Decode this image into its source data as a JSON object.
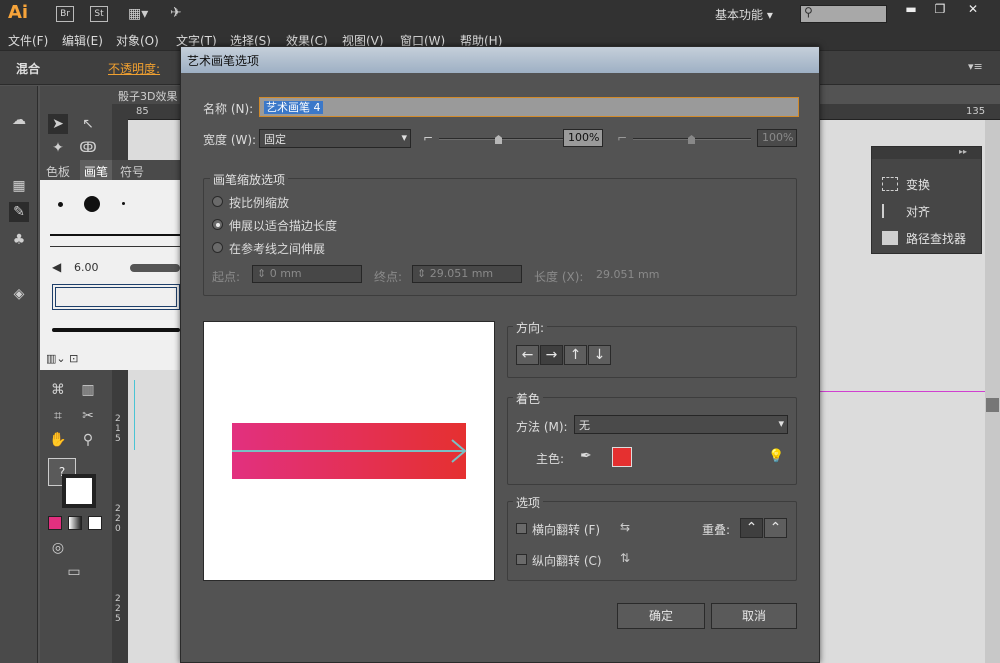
{
  "app": {
    "logo": "Ai",
    "bridge": "Br",
    "stock": "St",
    "workspace": "基本功能",
    "search_placeholder": ""
  },
  "menu": [
    "文件(F)",
    "编辑(E)",
    "对象(O)",
    "文字(T)",
    "选择(S)",
    "效果(C)",
    "视图(V)",
    "窗口(W)",
    "帮助(H)"
  ],
  "control_bar": {
    "blend": "混合",
    "opacity_label": "不透明度:"
  },
  "document_tab": "骰子3D效果",
  "rulers": {
    "top": [
      "85",
      "135"
    ],
    "left": [
      "2 1 5",
      "2 2 0",
      "2 2 5"
    ]
  },
  "brush_panel": {
    "tabs": [
      "色板",
      "画笔",
      "符号"
    ],
    "brush_size": "6.00"
  },
  "right_panel": {
    "items": [
      {
        "label": "变换",
        "icon": "transform-icon"
      },
      {
        "label": "对齐",
        "icon": "align-icon"
      },
      {
        "label": "路径查找器",
        "icon": "pathfinder-icon"
      }
    ]
  },
  "dialog": {
    "title": "艺术画笔选项",
    "name_label": "名称 (N):",
    "name_value": "艺术画笔 4",
    "width_label": "宽度 (W):",
    "width_value": "固定",
    "width_pct": "100%",
    "width_pct2": "100%",
    "scale_group": "画笔缩放选项",
    "scale_options": [
      "按比例缩放",
      "伸展以适合描边长度",
      "在参考线之间伸展"
    ],
    "scale_selected": 1,
    "start_label": "起点:",
    "start_value": "0 mm",
    "end_label": "终点:",
    "end_value": "29.051 mm",
    "length_label": "长度 (X):",
    "length_value": "29.051 mm",
    "direction_label": "方向:",
    "directions": [
      "←",
      "→",
      "↑",
      "↓"
    ],
    "direction_selected": 1,
    "coloring_group": "着色",
    "method_label": "方法 (M):",
    "method_value": "无",
    "key_color_label": "主色:",
    "key_color": "#e53030",
    "options_group": "选项",
    "flip_along": "横向翻转 (F)",
    "flip_across": "纵向翻转 (C)",
    "overlap_label": "重叠:",
    "ok": "确定",
    "cancel": "取消"
  },
  "colors": {
    "dialog_bg": "#535353",
    "accent_title": "#9eb0c4",
    "brush_gradient_start": "#e2307f",
    "brush_gradient_end": "#e53030"
  }
}
